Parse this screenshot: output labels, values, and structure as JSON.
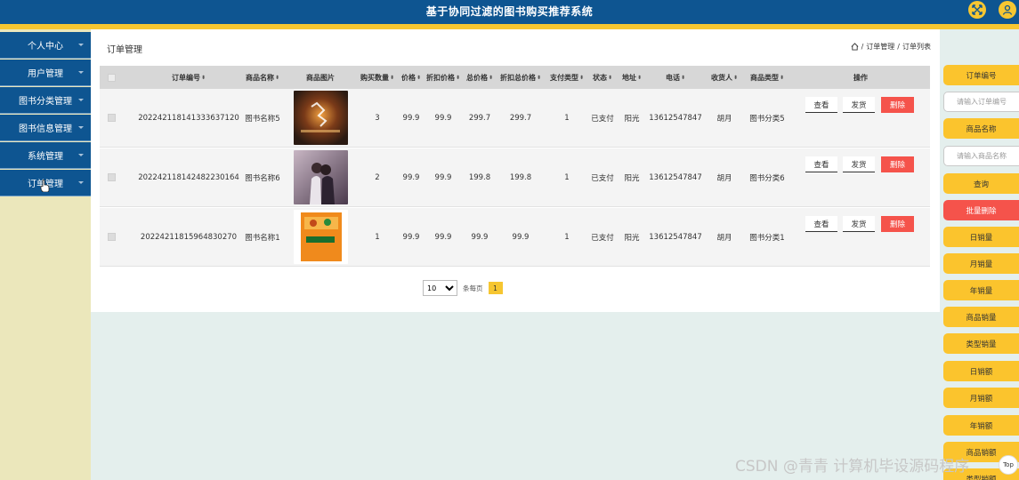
{
  "app": {
    "title": "基于协同过滤的图书购买推荐系统"
  },
  "sidebar": {
    "items": [
      {
        "label": "个人中心"
      },
      {
        "label": "用户管理"
      },
      {
        "label": "图书分类管理"
      },
      {
        "label": "图书信息管理"
      },
      {
        "label": "系统管理"
      },
      {
        "label": "订单管理"
      }
    ]
  },
  "page": {
    "title": "订单管理",
    "breadcrumb": [
      "订单管理",
      "订单列表"
    ],
    "breadcrumb_sep": "/"
  },
  "table": {
    "headers": [
      "订单编号",
      "商品名称",
      "商品图片",
      "购买数量",
      "价格",
      "折扣价格",
      "总价格",
      "折扣总价格",
      "支付类型",
      "状态",
      "地址",
      "电话",
      "收货人",
      "商品类型",
      "操作"
    ],
    "actions": {
      "view": "查看",
      "ship": "发货",
      "delete": "删除"
    },
    "rows": [
      {
        "order_no": "202242118141333637120",
        "name": "图书名称5",
        "image": "cover-dark-night-icon",
        "qty": "3",
        "price": "99.9",
        "discount_price": "99.9",
        "total": "299.7",
        "discount_total": "299.7",
        "pay_type": "1",
        "status": "已支付",
        "address": "阳光",
        "phone": "13612547847",
        "receiver": "胡月",
        "category": "图书分类5"
      },
      {
        "order_no": "202242118142482230164",
        "name": "图书名称6",
        "image": "cover-couple-photo-icon",
        "qty": "2",
        "price": "99.9",
        "discount_price": "99.9",
        "total": "199.8",
        "discount_total": "199.8",
        "pay_type": "1",
        "status": "已支付",
        "address": "阳光",
        "phone": "13612547847",
        "receiver": "胡月",
        "category": "图书分类6"
      },
      {
        "order_no": "20224211815964830270",
        "name": "图书名称1",
        "image": "cover-orange-book-icon",
        "qty": "1",
        "price": "99.9",
        "discount_price": "99.9",
        "total": "99.9",
        "discount_total": "99.9",
        "pay_type": "1",
        "status": "已支付",
        "address": "阳光",
        "phone": "13612547847",
        "receiver": "胡月",
        "category": "图书分类1"
      }
    ]
  },
  "pager": {
    "page_size": "10",
    "per_page_label": "条每页",
    "current_page": "1"
  },
  "filters": {
    "order_no_label": "订单编号",
    "order_no_placeholder": "请输入订单编号",
    "name_label": "商品名称",
    "name_placeholder": "请输入商品名称",
    "query": "查询",
    "batch_delete": "批量删除",
    "stats": [
      "日销量",
      "月销量",
      "年销量",
      "商品销量",
      "类型销量",
      "日销额",
      "月销额",
      "年销额",
      "商品销额",
      "类型销额"
    ]
  },
  "watermark": "CSDN @青青  计算机毕设源码程序",
  "back_to_top": "Top",
  "colors": {
    "primary": "#0e5591",
    "accent": "#f6c631",
    "button": "#fbc42d",
    "danger": "#f5534b"
  }
}
